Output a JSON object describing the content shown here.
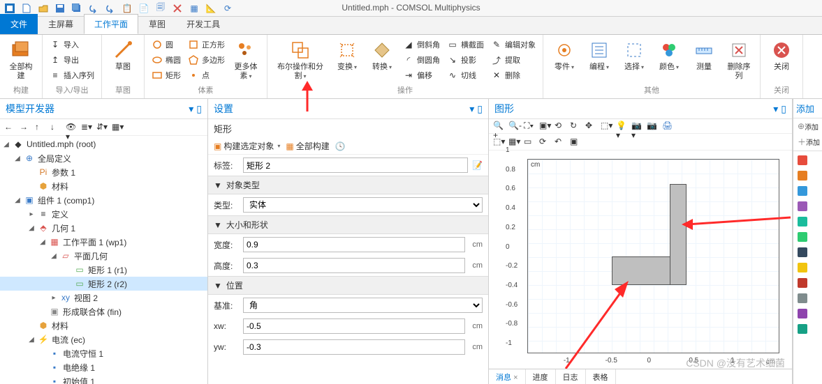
{
  "window": {
    "title": "Untitled.mph - COMSOL Multiphysics"
  },
  "tabs": {
    "file": "文件",
    "home": "主屏幕",
    "workplane": "工作平面",
    "sketch": "草图",
    "dev": "开发工具"
  },
  "ribbon": {
    "build": {
      "build_all": "全部构建",
      "group": "构建"
    },
    "io": {
      "import": "导入",
      "export": "导出",
      "insert": "插入序列",
      "group": "导入/导出",
      "sketch": "草图",
      "gsketch": "草图"
    },
    "primitives": {
      "circle": "圆",
      "square": "正方形",
      "ellipse": "椭圆",
      "polygon": "多边形",
      "rect": "矩形",
      "point": "点",
      "more": "更多体素",
      "group": "体素"
    },
    "ops": {
      "bool": "布尔操作和分割",
      "transform": "变换",
      "convert": "转换",
      "chamfer": "倒斜角",
      "cross": "横截面",
      "fillet": "倒圆角",
      "project": "投影",
      "offset": "偏移",
      "tangent": "切线",
      "edit": "编辑对象",
      "extract": "提取",
      "delete": "删除",
      "group": "操作"
    },
    "other": {
      "parts": "零件",
      "program": "编程",
      "select": "选择",
      "color": "颜色",
      "measure": "测量",
      "delseq": "删除序列",
      "group": "其他"
    },
    "close": {
      "close": "关闭",
      "group": "关闭"
    }
  },
  "model_panel": {
    "title": "模型开发器",
    "nodes": {
      "root": "Untitled.mph (root)",
      "global": "全局定义",
      "params": "参数 1",
      "materials": "材料",
      "comp": "组件 1 (comp1)",
      "def": "定义",
      "geom": "几何 1",
      "wp": "工作平面 1 (wp1)",
      "pg": "平面几何",
      "r1": "矩形 1 (r1)",
      "r2": "矩形 2 (r2)",
      "view": "视图 2",
      "fin": "形成联合体 (fin)",
      "mat": "材料",
      "ec": "电流 (ec)",
      "cc": "电流守恒 1",
      "ins": "电绝缘 1",
      "init": "初始值 1"
    }
  },
  "settings": {
    "title": "设置",
    "subtitle": "矩形",
    "build_sel": "构建选定对象",
    "build_all": "全部构建",
    "label_label": "标签:",
    "label_value": "矩形 2",
    "sect_type": "对象类型",
    "type_label": "类型:",
    "type_value": "实体",
    "sect_size": "大小和形状",
    "width_label": "宽度:",
    "width_value": "0.9",
    "height_label": "高度:",
    "height_value": "0.3",
    "sect_pos": "位置",
    "base_label": "基准:",
    "base_value": "角",
    "xw_label": "xw:",
    "xw_value": "-0.5",
    "yw_label": "yw:",
    "yw_value": "-0.3",
    "unit": "cm"
  },
  "graphics": {
    "title": "图形",
    "unit": "cm"
  },
  "bottom": {
    "msg": "消息",
    "prog": "进度",
    "log": "日志",
    "table": "表格"
  },
  "aside": {
    "title": "添加",
    "add1": "添加",
    "add2": "添加"
  },
  "watermark": "CSDN @没有艺术细菌",
  "chart_data": {
    "type": "scatter",
    "title": "",
    "xlabel": "cm",
    "ylabel": "cm",
    "xlim": [
      -1.5,
      1.5
    ],
    "ylim": [
      -1.0,
      1.0
    ],
    "xticks": [
      -1,
      -0.5,
      0,
      0.5,
      1
    ],
    "yticks": [
      -1,
      -0.8,
      -0.6,
      -0.4,
      -0.2,
      0,
      0.2,
      0.4,
      0.6,
      0.8,
      1
    ],
    "shapes": [
      {
        "type": "rect",
        "x": -0.5,
        "y": -0.3,
        "width": 0.9,
        "height": 0.3
      },
      {
        "type": "rect",
        "x": 0.2,
        "y": -0.3,
        "width": 0.2,
        "height": 1.05
      }
    ]
  }
}
